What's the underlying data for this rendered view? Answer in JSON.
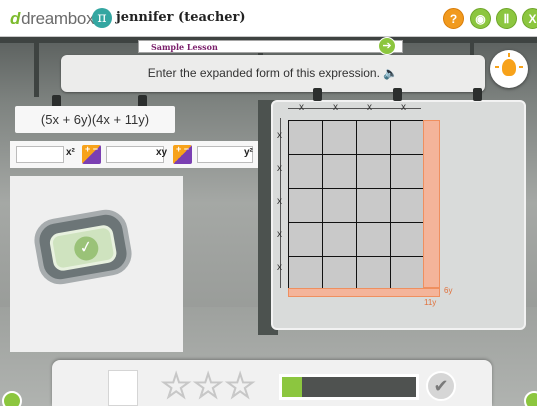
{
  "header": {
    "logo_mark": "d",
    "logo_text": "dreambox",
    "pi_symbol": "π",
    "user": "jennifer (teacher)",
    "help_glyph": "?",
    "sound_glyph": "◉",
    "pause_glyph": "Ⅱ",
    "close_glyph": "X"
  },
  "lesson": {
    "tag": "Sample Lesson",
    "next_glyph": "➔",
    "prompt": "Enter the expanded form of this expression. 🔈"
  },
  "expression": "(5x + 6y)(4x + 11y)",
  "answer_row": {
    "input1": "",
    "label1": "x²",
    "input2": "",
    "label2": "xy",
    "input3": "",
    "label3": "y²",
    "pm_glyph": "+ −"
  },
  "grid": {
    "top_labels": [
      "x",
      "x",
      "x",
      "x"
    ],
    "side_labels": [
      "x",
      "x",
      "x",
      "x",
      "x"
    ],
    "orange_right_label": "6y",
    "orange_bottom_label": "11y"
  },
  "bottom": {
    "stars": [
      "☆",
      "☆",
      "☆"
    ],
    "progress": 0.15,
    "done_glyph": "✔"
  },
  "colors": {
    "accent_green": "#8cc63f",
    "help_orange": "#f19a1e",
    "grid_orange": "#f4b49a"
  }
}
